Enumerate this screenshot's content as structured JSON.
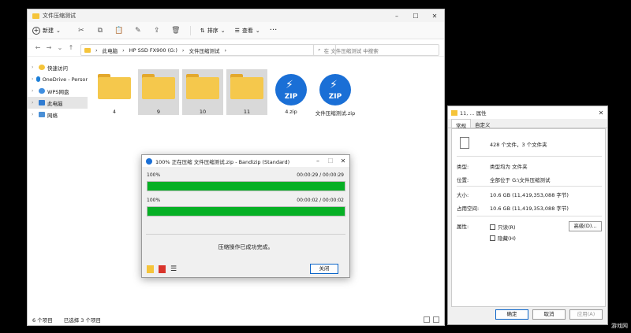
{
  "explorer": {
    "title": "文件压缩测试",
    "toolbar": {
      "new_label": "新建",
      "sort_label": "排序",
      "view_label": "查看",
      "more": "···"
    },
    "breadcrumb": [
      "此电脑",
      "HP SSD FX900 (G:)",
      "文件压缩测试"
    ],
    "search_placeholder": "在 文件压缩测试 中搜索",
    "sidebar": [
      {
        "label": "快速访问",
        "expand": true
      },
      {
        "label": "OneDrive - Persor",
        "expand": true
      },
      {
        "label": "WPS网盘",
        "expand": true
      },
      {
        "label": "此电脑",
        "expand": true,
        "active": true
      },
      {
        "label": "网络",
        "expand": true
      }
    ],
    "files": [
      {
        "name": "4",
        "type": "folder",
        "selected": false
      },
      {
        "name": "9",
        "type": "folder",
        "selected": true
      },
      {
        "name": "10",
        "type": "folder",
        "selected": true
      },
      {
        "name": "11",
        "type": "folder",
        "selected": true
      },
      {
        "name": "4.zip",
        "type": "zip",
        "selected": false
      },
      {
        "name": "文件压缩测试.zip",
        "type": "zip",
        "selected": false
      }
    ],
    "status_count": "6 个项目",
    "status_selected": "已选择 3 个项目"
  },
  "properties": {
    "title": "11, ... 属性",
    "tabs": [
      "常规",
      "自定义"
    ],
    "summary": "428 个文件，3 个文件夹",
    "rows": [
      {
        "k": "类型:",
        "v": "类型均为 文件夹"
      },
      {
        "k": "位置:",
        "v": "全部位于 G:\\文件压缩测试"
      },
      {
        "k": "大小:",
        "v": "10.6 GB (11,419,353,088 字节)"
      },
      {
        "k": "占用空间:",
        "v": "10.6 GB (11,419,353,088 字节)"
      }
    ],
    "attr_label": "属性:",
    "readonly_label": "只读(R)",
    "hidden_label": "隐藏(H)",
    "advanced_label": "高级(D)...",
    "ok_label": "确定",
    "cancel_label": "取消",
    "apply_label": "应用(A)"
  },
  "bandizip": {
    "title": "100% 正在压缩 文件压缩测试.zip - Bandizip (Standard)",
    "progress1": {
      "percent_label": "100%",
      "time": "00:00:29 / 00:00:29",
      "value": 1.0
    },
    "progress2": {
      "percent_label": "100%",
      "time": "00:00:02 / 00:00:02",
      "value": 1.0
    },
    "message": "压缩操作已成功完成。",
    "close_label": "关闭",
    "colors": {
      "progress": "#06b025"
    }
  },
  "watermark": "游戏网"
}
